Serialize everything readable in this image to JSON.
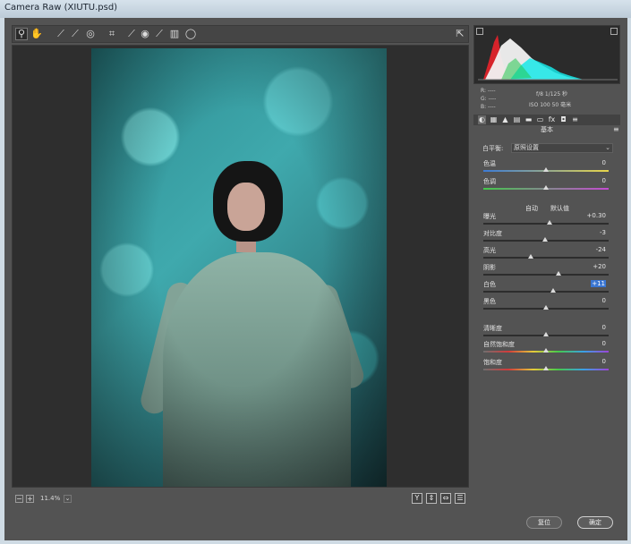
{
  "window": {
    "title": "Camera Raw (XIUTU.psd)"
  },
  "toolbar": {
    "tools": [
      {
        "name": "zoom-tool",
        "icon": "magnifier-icon",
        "glyph": "⚲",
        "active": true
      },
      {
        "name": "hand-tool",
        "icon": "hand-icon",
        "glyph": "✋"
      },
      {
        "name": "white-balance-tool",
        "icon": "eyedropper-icon",
        "glyph": "⟋"
      },
      {
        "name": "color-sampler-tool",
        "icon": "color-sampler-icon",
        "glyph": "⟋"
      },
      {
        "name": "targeted-adjustment-tool",
        "icon": "target-adjust-icon",
        "glyph": "◎"
      },
      {
        "name": "crop-tool",
        "icon": "crop-icon",
        "glyph": "⌗"
      },
      {
        "name": "straighten-tool",
        "icon": "straighten-icon",
        "glyph": "⟋"
      },
      {
        "name": "redeye-tool",
        "icon": "eye-icon",
        "glyph": "◉"
      },
      {
        "name": "adjustment-brush-tool",
        "icon": "brush-icon",
        "glyph": "⟋"
      },
      {
        "name": "graduated-filter-tool",
        "icon": "graduated-filter-icon",
        "glyph": "▥"
      },
      {
        "name": "radial-filter-tool",
        "icon": "radial-filter-icon",
        "glyph": "◯"
      }
    ],
    "export_icon": "open-preferences-icon"
  },
  "bottom_bar": {
    "zoom_value": "11.4%",
    "zoom_out_icon": "minus-icon",
    "zoom_in_icon": "plus-icon",
    "dropdown_icon": "chevron-down-icon",
    "view_buttons": [
      {
        "name": "before-after-toggle",
        "glyph": "Y"
      },
      {
        "name": "swap-before-after",
        "glyph": "⇕"
      },
      {
        "name": "copy-settings",
        "glyph": "⇔"
      },
      {
        "name": "toggle-settings",
        "glyph": "☰"
      }
    ]
  },
  "camera_info": {
    "r": "R: ----",
    "g": "G: ----",
    "b": "B: ----",
    "aperture_shutter": "f/8   1/125 秒",
    "iso_lens": "ISO 100   50 毫米"
  },
  "panel_tabs": [
    {
      "name": "tab-basic",
      "glyph": "◐",
      "active": true
    },
    {
      "name": "tab-tone-curve",
      "glyph": "▦"
    },
    {
      "name": "tab-detail",
      "glyph": "▲"
    },
    {
      "name": "tab-hsl",
      "glyph": "▤"
    },
    {
      "name": "tab-split-toning",
      "glyph": "▬"
    },
    {
      "name": "tab-lens",
      "glyph": "▭"
    },
    {
      "name": "tab-fx",
      "glyph": "fx"
    },
    {
      "name": "tab-camera-calibration",
      "glyph": "◘"
    },
    {
      "name": "tab-presets",
      "glyph": "≡"
    }
  ],
  "panel": {
    "title": "基本",
    "menu_icon": "panel-menu-icon",
    "white_balance_label": "白平衡:",
    "white_balance_value": "原照设置",
    "auto_label": "自动",
    "default_label": "默认值",
    "sliders": [
      {
        "name": "temperature",
        "label": "色温",
        "value": "0",
        "pos": 0.5
      },
      {
        "name": "tint",
        "label": "色调",
        "value": "0",
        "pos": 0.5
      },
      {
        "name": "exposure",
        "label": "曝光",
        "value": "+0.30",
        "pos": 0.53
      },
      {
        "name": "contrast",
        "label": "对比度",
        "value": "-3",
        "pos": 0.49
      },
      {
        "name": "highlights",
        "label": "高光",
        "value": "-24",
        "pos": 0.38
      },
      {
        "name": "shadows",
        "label": "阴影",
        "value": "+20",
        "pos": 0.6
      },
      {
        "name": "whites",
        "label": "白色",
        "value": "+11",
        "pos": 0.56,
        "selected": true
      },
      {
        "name": "blacks",
        "label": "黑色",
        "value": "0",
        "pos": 0.5
      },
      {
        "name": "clarity",
        "label": "清晰度",
        "value": "0",
        "pos": 0.5
      },
      {
        "name": "vibrance",
        "label": "自然饱和度",
        "value": "0",
        "pos": 0.5
      },
      {
        "name": "saturation",
        "label": "饱和度",
        "value": "0",
        "pos": 0.5
      }
    ]
  },
  "footer": {
    "reset_label": "复位",
    "ok_label": "确定"
  },
  "colors": {
    "panel_bg": "#535353",
    "accent_selection": "#3a76d2"
  }
}
